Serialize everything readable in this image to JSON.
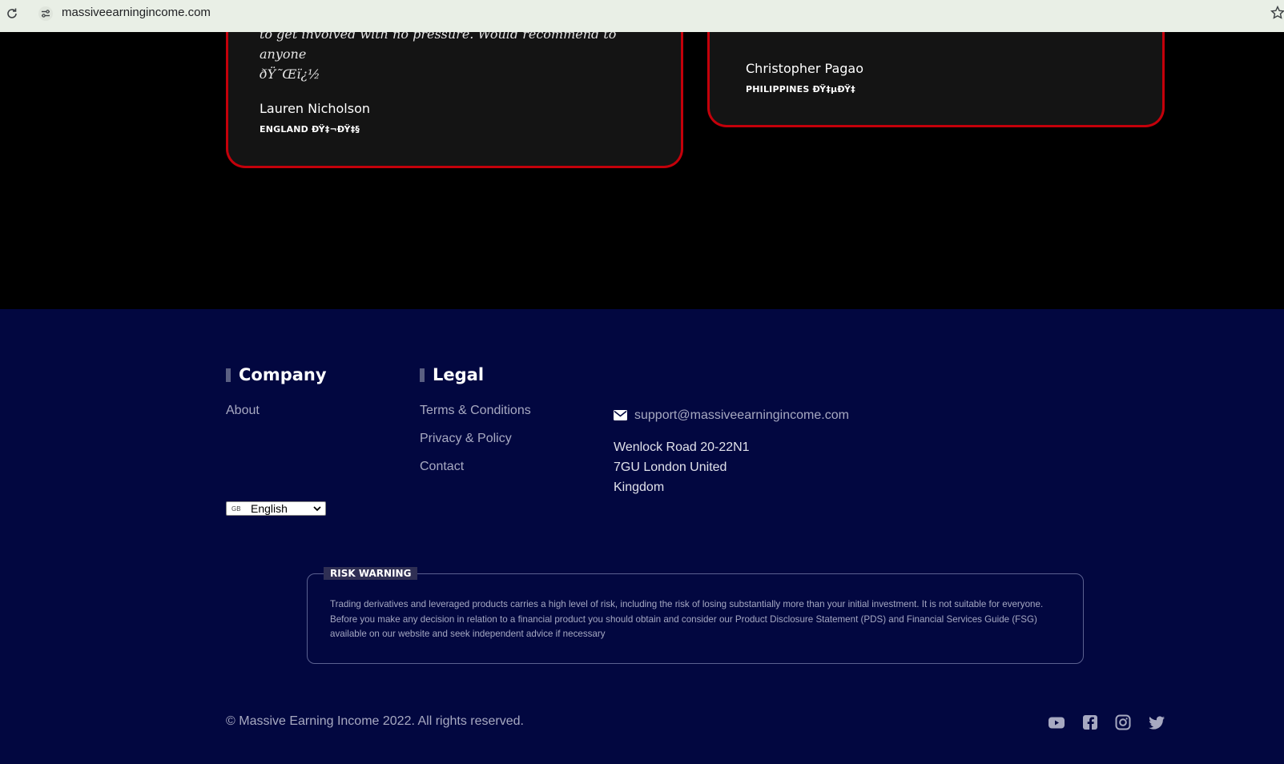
{
  "browser": {
    "url": "massiveearningincome.com"
  },
  "testimonials": [
    {
      "quote_visible": "to get involved with no pressure. Would recommend to anyone",
      "quote_tail": "ðŸ˜Œï¿½",
      "name": "Lauren Nicholson",
      "country": "ENGLAND ĐŸ‡¬ĐŸ‡§"
    },
    {
      "name": "Christopher Pagao",
      "country": "PHILIPPINES ĐŸ‡µĐŸ‡"
    }
  ],
  "footer": {
    "company": {
      "heading": "Company",
      "links": [
        "About"
      ]
    },
    "legal": {
      "heading": "Legal",
      "links": [
        "Terms & Conditions",
        "Privacy & Policy",
        "Contact"
      ]
    },
    "contact": {
      "email": "support@massiveearningincome.com",
      "address_lines": [
        "Wenlock Road 20-22N1",
        "7GU London United",
        "Kingdom"
      ]
    },
    "language": {
      "flag": "GB",
      "selected": "English"
    },
    "risk_warning": {
      "label": "RISK WARNING",
      "text": "Trading derivatives and leveraged products carries a high level of risk, including the risk of losing substantially more than your initial investment. It is not suitable for everyone. Before you make any decision in relation to a financial product you should obtain and consider our Product Disclosure Statement (PDS) and Financial Services Guide (FSG) available on our website and seek independent advice if necessary"
    },
    "copyright": "© Massive Earning Income 2022. All rights reserved.",
    "social_icons": [
      "youtube-icon",
      "facebook-icon",
      "instagram-icon",
      "twitter-icon"
    ]
  },
  "colors": {
    "footer_bg": "#020740",
    "card_border": "#c4000a",
    "card_bg": "#141414"
  }
}
